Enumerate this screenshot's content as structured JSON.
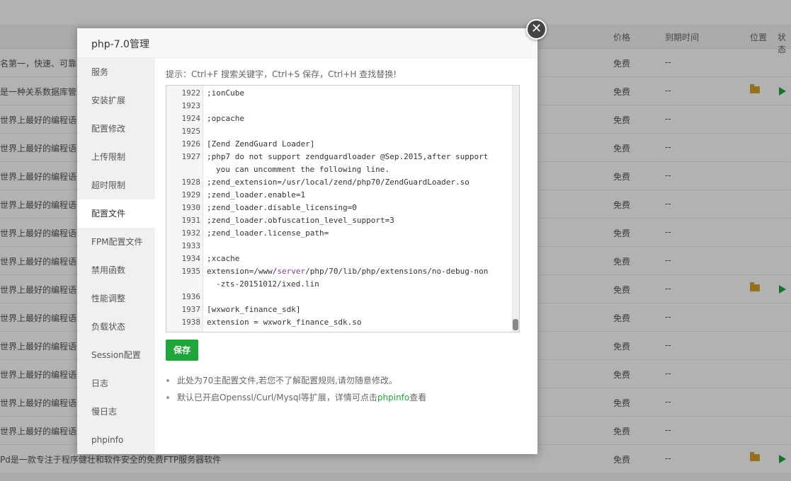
{
  "background": {
    "header": {
      "price": "价格",
      "expire": "到期时间",
      "location": "位置",
      "status": "状态"
    },
    "rows": [
      {
        "desc": "名第一，快速、可靠并",
        "price": "免费",
        "expire": "--",
        "folder": false,
        "play": false
      },
      {
        "desc": "是一种关系数据库管理",
        "price": "免费",
        "expire": "--",
        "folder": true,
        "play": true
      },
      {
        "desc": "世界上最好的编程语言",
        "price": "免费",
        "expire": "--",
        "folder": false,
        "play": false
      },
      {
        "desc": "世界上最好的编程语言",
        "price": "免费",
        "expire": "--",
        "folder": false,
        "play": false
      },
      {
        "desc": "世界上最好的编程语言",
        "price": "免费",
        "expire": "--",
        "folder": false,
        "play": false
      },
      {
        "desc": "世界上最好的编程语言",
        "price": "免费",
        "expire": "--",
        "folder": false,
        "play": false
      },
      {
        "desc": "世界上最好的编程语言",
        "price": "免费",
        "expire": "--",
        "folder": false,
        "play": false
      },
      {
        "desc": "世界上最好的编程语言",
        "price": "免费",
        "expire": "--",
        "folder": false,
        "play": false
      },
      {
        "desc": "世界上最好的编程语言",
        "price": "免费",
        "expire": "--",
        "folder": true,
        "play": true
      },
      {
        "desc": "世界上最好的编程语言",
        "price": "免费",
        "expire": "--",
        "folder": false,
        "play": false
      },
      {
        "desc": "世界上最好的编程语言",
        "price": "免费",
        "expire": "--",
        "folder": false,
        "play": false
      },
      {
        "desc": "世界上最好的编程语言",
        "price": "免费",
        "expire": "--",
        "folder": false,
        "play": false
      },
      {
        "desc": "世界上最好的编程语言",
        "price": "免费",
        "expire": "--",
        "folder": false,
        "play": false
      },
      {
        "desc": "世界上最好的编程语言",
        "price": "免费",
        "expire": "--",
        "folder": false,
        "play": false
      },
      {
        "desc": "Pd是一款专注于程序健壮和软件安全的免费FTP服务器软件",
        "price": "免费",
        "expire": "--",
        "folder": true,
        "play": true
      }
    ]
  },
  "modal": {
    "title": "php-7.0管理",
    "close_symbol": "✕",
    "sidebar": [
      {
        "label": "服务",
        "active": false
      },
      {
        "label": "安装扩展",
        "active": false
      },
      {
        "label": "配置修改",
        "active": false
      },
      {
        "label": "上传限制",
        "active": false
      },
      {
        "label": "超时限制",
        "active": false
      },
      {
        "label": "配置文件",
        "active": true
      },
      {
        "label": "FPM配置文件",
        "active": false
      },
      {
        "label": "禁用函数",
        "active": false
      },
      {
        "label": "性能调整",
        "active": false
      },
      {
        "label": "负载状态",
        "active": false
      },
      {
        "label": "Session配置",
        "active": false
      },
      {
        "label": "日志",
        "active": false
      },
      {
        "label": "慢日志",
        "active": false
      },
      {
        "label": "phpinfo",
        "active": false
      }
    ],
    "tip": "提示：Ctrl+F 搜索关键字，Ctrl+S 保存，Ctrl+H 查找替换!",
    "editor_lines": [
      {
        "num": "1922",
        "text": ";ionCube"
      },
      {
        "num": "1923",
        "text": ""
      },
      {
        "num": "1924",
        "text": ";opcache"
      },
      {
        "num": "1925",
        "text": ""
      },
      {
        "num": "1926",
        "text": "[Zend ZendGuard Loader]"
      },
      {
        "num": "1927",
        "text": ";php7 do not support zendguardloader @Sep.2015,after support",
        "cont": "you can uncomment the following line."
      },
      {
        "num": "1928",
        "text": ";zend_extension=/usr/local/zend/php70/ZendGuardLoader.so"
      },
      {
        "num": "1929",
        "text": ";zend_loader.enable=1"
      },
      {
        "num": "1930",
        "text": ";zend_loader.disable_licensing=0"
      },
      {
        "num": "1931",
        "text": ";zend_loader.obfuscation_level_support=3"
      },
      {
        "num": "1932",
        "text": ";zend_loader.license_path="
      },
      {
        "num": "1933",
        "text": ""
      },
      {
        "num": "1934",
        "text": ";xcache"
      },
      {
        "num": "1935",
        "pre": "extension=/www/",
        "kw": "server",
        "post": "/php/70/lib/php/extensions/no-debug-non",
        "cont": "-zts-20151012/ixed.lin"
      },
      {
        "num": "1936",
        "text": ""
      },
      {
        "num": "1937",
        "text": "[wxwork_finance_sdk]"
      },
      {
        "num": "1938",
        "text": "extension = wxwork_finance_sdk.so"
      }
    ],
    "save_label": "保存",
    "notes": {
      "note1": "此处为70主配置文件,若您不了解配置规则,请勿随意修改。",
      "note2_pre": "默认已开启Openssl/Curl/Mysql等扩展，详情可点击",
      "note2_link": "phpinfo",
      "note2_post": "查看"
    }
  }
}
